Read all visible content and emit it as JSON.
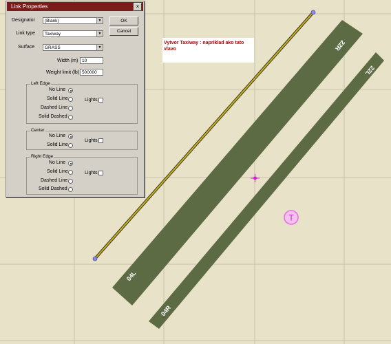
{
  "canvas": {
    "background": "#e8e2c8",
    "grid_color": "#c7c2ad",
    "taxiway_color": "#5c6b43",
    "link_line_color": "#c9b020",
    "node_color": "#8a8ae0",
    "target_color": "#e070e0",
    "marker_color": "#d020d0",
    "runway_labels": {
      "wide_top": "22R",
      "wide_bottom": "04L",
      "narrow_top": "22L",
      "narrow_bottom": "04R"
    },
    "tower_symbol": "T"
  },
  "note": {
    "text": "Vytvor Taxiway : napriklad ako tato vlavo"
  },
  "dialog": {
    "title": "Link Properties",
    "close_label": "×",
    "ok_label": "OK",
    "cancel_label": "Cancel",
    "designator": {
      "label": "Designator",
      "value": "(Blank)"
    },
    "link_type": {
      "label": "Link type",
      "value": "Taxiway"
    },
    "surface": {
      "label": "Surface",
      "value": "GRASS"
    },
    "width": {
      "label": "Width (m)",
      "value": "10"
    },
    "weight": {
      "label": "Weight limit (lb)",
      "value": "500000"
    },
    "left_edge": {
      "title": "Left Edge",
      "options": [
        "No Line",
        "Solid Line",
        "Dashed Line",
        "Solid Dashed"
      ],
      "selected": "No Line",
      "lights_label": "Lights"
    },
    "center": {
      "title": "Center",
      "options": [
        "No Line",
        "Solid Line"
      ],
      "selected": "No Line",
      "lights_label": "Lights"
    },
    "right_edge": {
      "title": "Right Edge",
      "options": [
        "No Line",
        "Solid Line",
        "Dashed Line",
        "Solid Dashed"
      ],
      "selected": "No Line",
      "lights_label": "Lights"
    }
  }
}
